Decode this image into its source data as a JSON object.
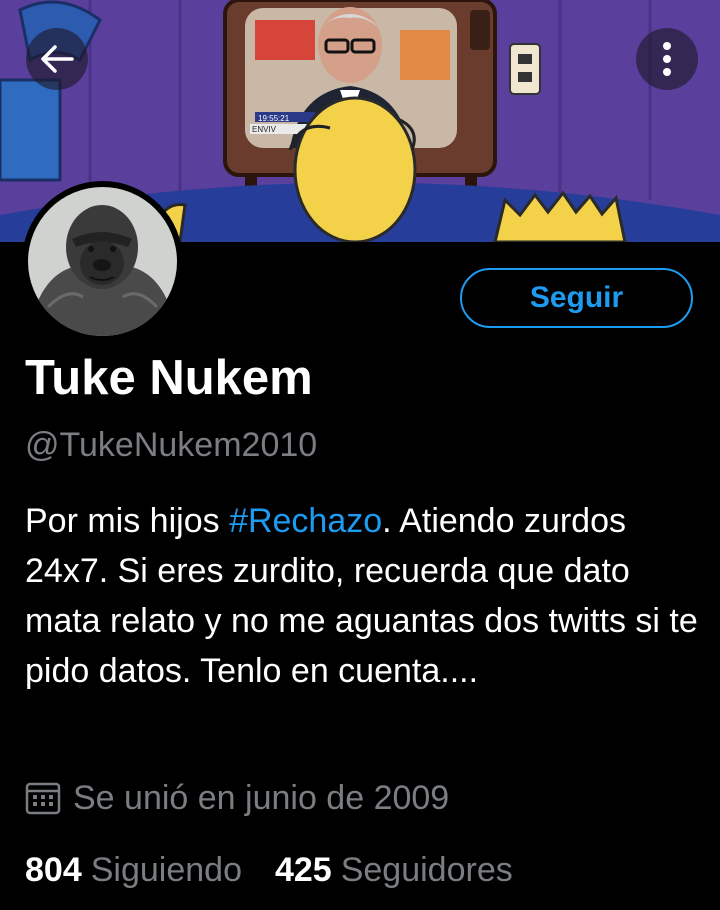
{
  "header": {
    "back_icon": "arrow-left-icon",
    "more_icon": "more-vertical-icon"
  },
  "banner": {
    "tv_clock": "19:55:21",
    "tv_ticker": "ENVIV"
  },
  "profile": {
    "name": "Tuke Nukem",
    "handle": "@TukeNukem2010",
    "follow_label": "Seguir",
    "bio": {
      "before": "Por mis hijos ",
      "hashtag": "#Rechazo",
      "after": ". Atiendo zurdos 24x7. Si eres zurdito, recuerda que dato mata relato y no me aguantas dos twitts si te pido datos. Tenlo en cuenta...."
    },
    "joined_icon": "calendar-icon",
    "joined": "Se unió en junio de 2009",
    "following_count": "804",
    "following_label": "Siguiendo",
    "followers_count": "425",
    "followers_label": "Seguidores"
  },
  "colors": {
    "accent": "#1d9bf0",
    "background": "#000000",
    "secondary_text": "#7a7d81"
  }
}
